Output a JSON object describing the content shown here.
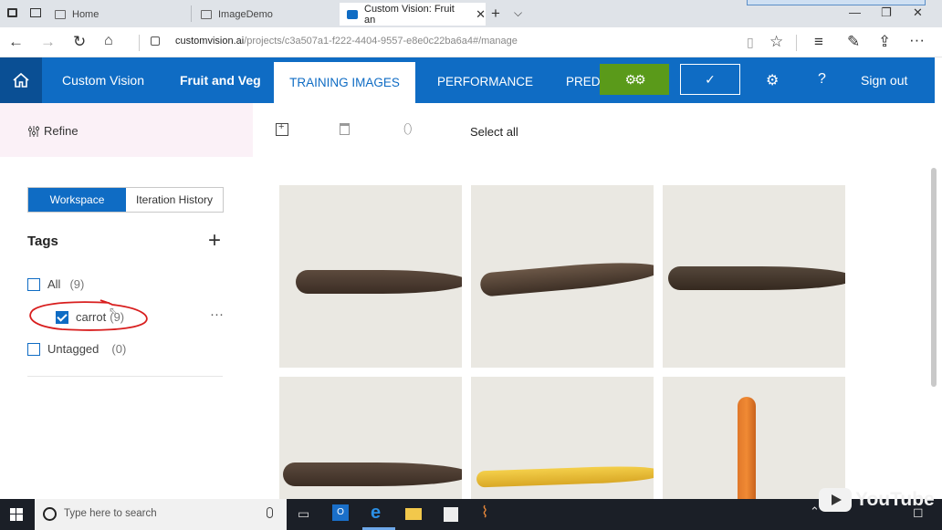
{
  "browser": {
    "tabs": [
      {
        "label": "Home"
      },
      {
        "label": "ImageDemo"
      },
      {
        "label": "Custom Vision: Fruit an"
      }
    ],
    "url_host": "customvision.ai",
    "url_path": "/projects/c3a507a1-f222-4404-9557-e8e0c22ba6a4#/manage"
  },
  "header": {
    "brand": "Custom Vision",
    "project": "Fruit and Veg",
    "tabs": [
      "TRAINING IMAGES",
      "PERFORMANCE",
      "PREDI"
    ],
    "sign_out": "Sign out",
    "help": "?"
  },
  "toolbar": {
    "refine": "Refine",
    "select_all": "Select all"
  },
  "left_panel": {
    "workspace_tab": "Workspace",
    "iteration_tab": "Iteration History",
    "tags_title": "Tags",
    "tags": [
      {
        "label": "All",
        "count": "(9)",
        "checked": false
      },
      {
        "label": "carrot",
        "count": "(9)",
        "checked": true
      },
      {
        "label": "Untagged",
        "count": "(0)",
        "checked": false
      }
    ],
    "more": "···"
  },
  "taskbar": {
    "search_placeholder": "Type here to search"
  },
  "watermark": {
    "text": "YouTube"
  },
  "colors": {
    "accent": "#0f6cc4",
    "train_button": "#5a9a1a",
    "annotation": "#d81e1e"
  }
}
